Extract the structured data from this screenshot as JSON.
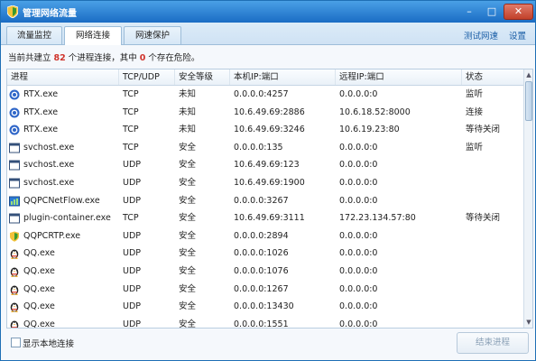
{
  "window": {
    "title": "管理网络流量"
  },
  "tabs": [
    {
      "label": "流量监控"
    },
    {
      "label": "网络连接"
    },
    {
      "label": "网速保护"
    }
  ],
  "links": {
    "speedtest": "测试网速",
    "settings": "设置"
  },
  "summary": {
    "prefix": "当前共建立",
    "process_count": "82",
    "middle": "个进程连接，其中",
    "danger_count": "0",
    "suffix": "个存在危险。"
  },
  "columns": [
    "进程",
    "TCP/UDP",
    "安全等级",
    "本机IP:端口",
    "远程IP:端口",
    "状态"
  ],
  "rows": [
    {
      "icon": "rtx-icon",
      "name": "RTX.exe",
      "proto": "TCP",
      "level": "未知",
      "local": "0.0.0.0:4257",
      "remote": "0.0.0.0:0",
      "state": "监听"
    },
    {
      "icon": "rtx-icon",
      "name": "RTX.exe",
      "proto": "TCP",
      "level": "未知",
      "local": "10.6.49.69:2886",
      "remote": "10.6.18.52:8000",
      "state": "连接"
    },
    {
      "icon": "rtx-icon",
      "name": "RTX.exe",
      "proto": "TCP",
      "level": "未知",
      "local": "10.6.49.69:3246",
      "remote": "10.6.19.23:80",
      "state": "等待关闭"
    },
    {
      "icon": "window-icon",
      "name": "svchost.exe",
      "proto": "TCP",
      "level": "安全",
      "local": "0.0.0.0:135",
      "remote": "0.0.0.0:0",
      "state": "监听"
    },
    {
      "icon": "window-icon",
      "name": "svchost.exe",
      "proto": "UDP",
      "level": "安全",
      "local": "10.6.49.69:123",
      "remote": "0.0.0.0:0",
      "state": ""
    },
    {
      "icon": "window-icon",
      "name": "svchost.exe",
      "proto": "UDP",
      "level": "安全",
      "local": "10.6.49.69:1900",
      "remote": "0.0.0.0:0",
      "state": ""
    },
    {
      "icon": "netflow-icon",
      "name": "QQPCNetFlow.exe",
      "proto": "UDP",
      "level": "安全",
      "local": "0.0.0.0:3267",
      "remote": "0.0.0.0:0",
      "state": ""
    },
    {
      "icon": "window-icon",
      "name": "plugin-container.exe",
      "proto": "TCP",
      "level": "安全",
      "local": "10.6.49.69:3111",
      "remote": "172.23.134.57:80",
      "state": "等待关闭"
    },
    {
      "icon": "shield-icon",
      "name": "QQPCRTP.exe",
      "proto": "UDP",
      "level": "安全",
      "local": "0.0.0.0:2894",
      "remote": "0.0.0.0:0",
      "state": ""
    },
    {
      "icon": "penguin-icon",
      "name": "QQ.exe",
      "proto": "UDP",
      "level": "安全",
      "local": "0.0.0.0:1026",
      "remote": "0.0.0.0:0",
      "state": ""
    },
    {
      "icon": "penguin-icon",
      "name": "QQ.exe",
      "proto": "UDP",
      "level": "安全",
      "local": "0.0.0.0:1076",
      "remote": "0.0.0.0:0",
      "state": ""
    },
    {
      "icon": "penguin-icon",
      "name": "QQ.exe",
      "proto": "UDP",
      "level": "安全",
      "local": "0.0.0.0:1267",
      "remote": "0.0.0.0:0",
      "state": ""
    },
    {
      "icon": "penguin-icon",
      "name": "QQ.exe",
      "proto": "UDP",
      "level": "安全",
      "local": "0.0.0.0:13430",
      "remote": "0.0.0.0:0",
      "state": ""
    },
    {
      "icon": "penguin-icon",
      "name": "QQ.exe",
      "proto": "UDP",
      "level": "安全",
      "local": "0.0.0.0:1551",
      "remote": "0.0.0.0:0",
      "state": ""
    }
  ],
  "footer": {
    "show_local_label": "显示本地连接",
    "end_process": "结束进程"
  }
}
